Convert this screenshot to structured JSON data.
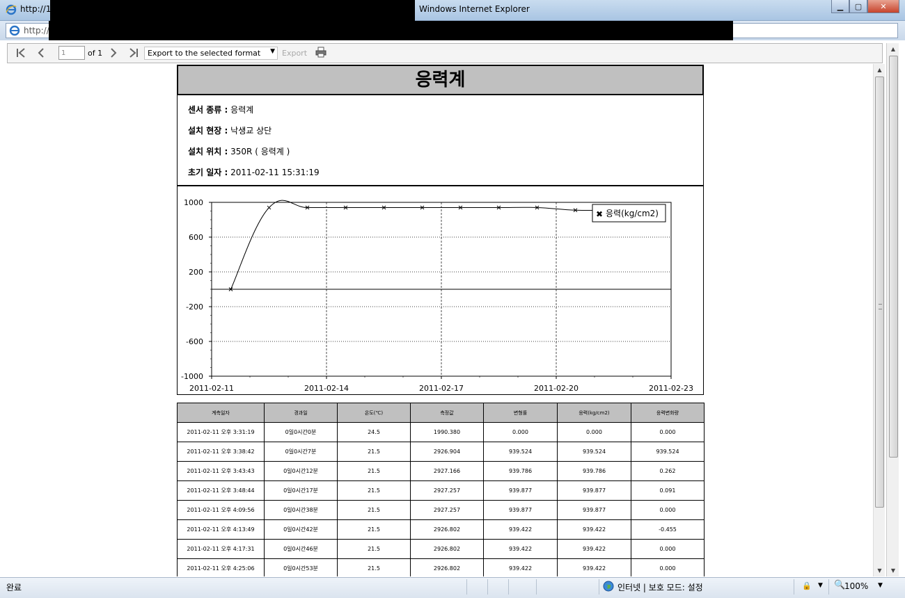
{
  "window": {
    "title_url": "http://12",
    "app_name": "Windows Internet Explorer",
    "address_url": "http://12"
  },
  "toolbar": {
    "page_number": "1",
    "of_pages": "of 1",
    "export_format": "Export to the selected format",
    "export_label": "Export"
  },
  "report": {
    "title": "응력계",
    "info": [
      {
        "label": "센서 종류 :",
        "value": "응력계"
      },
      {
        "label": "설치 현장 :",
        "value": "낙생교 상단"
      },
      {
        "label": "설치 위치 :",
        "value": "350R ( 응력계 )"
      },
      {
        "label": "초기 일자 :",
        "value": "2011-02-11 15:31:19"
      }
    ]
  },
  "chart_data": {
    "type": "line",
    "y_ticks": [
      "1000",
      "600",
      "200",
      "-200",
      "-600",
      "-1000"
    ],
    "x_ticks": [
      "2011-02-11",
      "2011-02-14",
      "2011-02-17",
      "2011-02-20",
      "2011-02-23"
    ],
    "ylim": [
      -1000,
      1000
    ],
    "xlim": [
      "2011-02-11",
      "2011-02-23"
    ],
    "series": [
      {
        "name": "응력(kg/cm2)",
        "x": [
          "2011-02-11T12:00",
          "2011-02-12T12:00",
          "2011-02-13T12:00",
          "2011-02-14T12:00",
          "2011-02-15T12:00",
          "2011-02-16T12:00",
          "2011-02-17T12:00",
          "2011-02-18T12:00",
          "2011-02-19T12:00",
          "2011-02-20T12:00",
          "2011-02-21T12:00",
          "2011-02-22T00:00"
        ],
        "y": [
          0,
          939.524,
          939.786,
          939.877,
          939.877,
          939.877,
          939.877,
          939.877,
          939.877,
          910,
          910,
          910
        ]
      }
    ],
    "legend_position": "top-right",
    "grid": true
  },
  "table": {
    "headers": [
      "계측일자",
      "경과일",
      "온도(℃)",
      "측정값",
      "변형률",
      "응력(kg/cm2)",
      "응력변화량"
    ],
    "rows": [
      [
        "2011-02-11 오후 3:31:19",
        "0일0시간0분",
        "24.5",
        "1990.380",
        "0.000",
        "0.000",
        "0.000"
      ],
      [
        "2011-02-11 오후 3:38:42",
        "0일0시간7분",
        "21.5",
        "2926.904",
        "939.524",
        "939.524",
        "939.524"
      ],
      [
        "2011-02-11 오후 3:43:43",
        "0일0시간12분",
        "21.5",
        "2927.166",
        "939.786",
        "939.786",
        "0.262"
      ],
      [
        "2011-02-11 오후 3:48:44",
        "0일0시간17분",
        "21.5",
        "2927.257",
        "939.877",
        "939.877",
        "0.091"
      ],
      [
        "2011-02-11 오후 4:09:56",
        "0일0시간38분",
        "21.5",
        "2927.257",
        "939.877",
        "939.877",
        "0.000"
      ],
      [
        "2011-02-11 오후 4:13:49",
        "0일0시간42분",
        "21.5",
        "2926.802",
        "939.422",
        "939.422",
        "-0.455"
      ],
      [
        "2011-02-11 오후 4:17:31",
        "0일0시간46분",
        "21.5",
        "2926.802",
        "939.422",
        "939.422",
        "0.000"
      ],
      [
        "2011-02-11 오후 4:25:06",
        "0일0시간53분",
        "21.5",
        "2926.802",
        "939.422",
        "939.422",
        "0.000"
      ]
    ]
  },
  "statusbar": {
    "status_text": "완료",
    "zone_text": "인터넷 | 보호 모드: 설정",
    "zoom": "100%"
  }
}
